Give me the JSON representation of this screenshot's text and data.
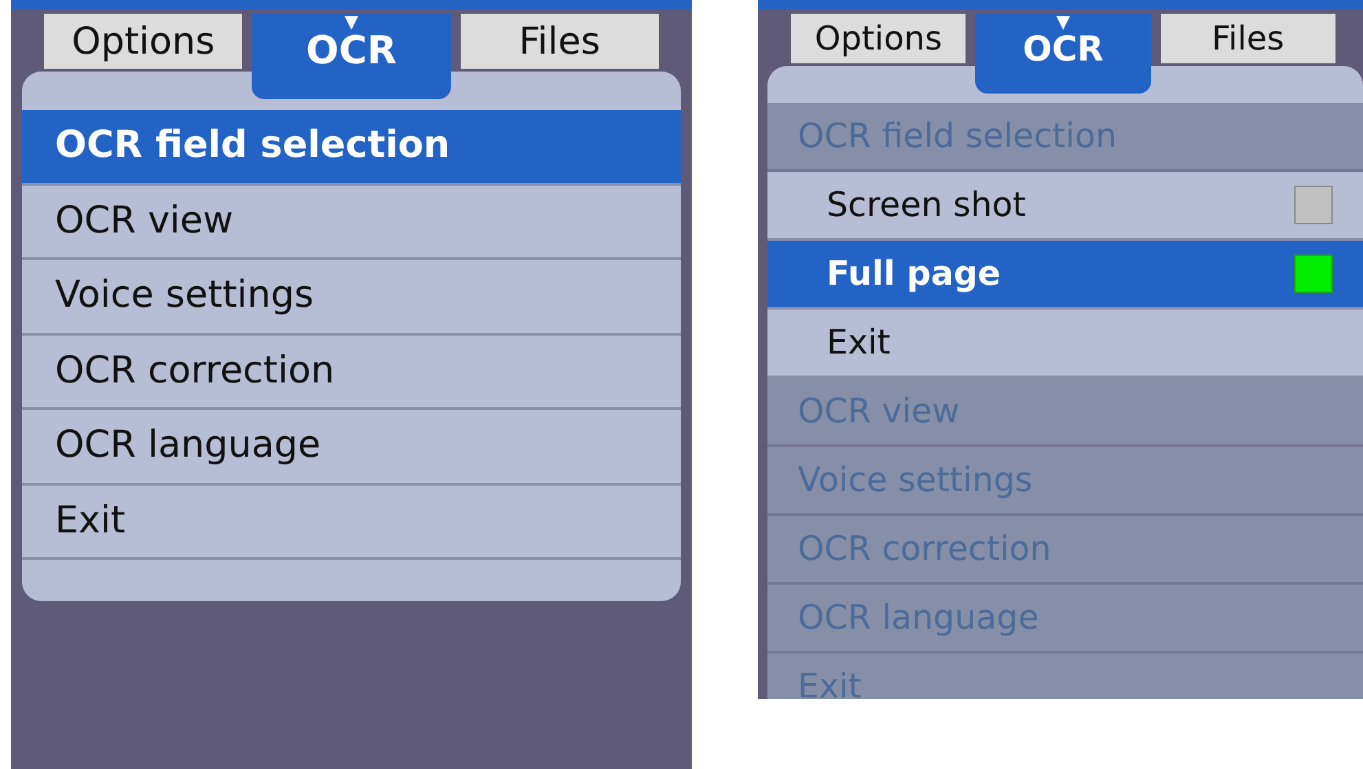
{
  "screens": [
    {
      "tabs": [
        {
          "label": "Options",
          "selected": false
        },
        {
          "label": "OCR",
          "selected": true,
          "indicator": "▼"
        },
        {
          "label": "Files",
          "selected": false
        }
      ],
      "menu": [
        {
          "label": "OCR field selection",
          "selected": true,
          "disabled": false
        },
        {
          "label": "OCR view",
          "selected": false,
          "disabled": false
        },
        {
          "label": "Voice settings",
          "selected": false,
          "disabled": false
        },
        {
          "label": "OCR correction",
          "selected": false,
          "disabled": false
        },
        {
          "label": "OCR language",
          "selected": false,
          "disabled": false
        },
        {
          "label": "Exit",
          "selected": false,
          "disabled": false
        }
      ]
    },
    {
      "tabs": [
        {
          "label": "Options",
          "selected": false
        },
        {
          "label": "OCR",
          "selected": true,
          "indicator": "▼"
        },
        {
          "label": "Files",
          "selected": false
        }
      ],
      "menu": [
        {
          "label": "OCR field selection",
          "selected": false,
          "disabled": true,
          "children": [
            {
              "kind": "option",
              "label": "Screen shot",
              "selected": false,
              "checked": false
            },
            {
              "kind": "option",
              "label": "Full page",
              "selected": true,
              "checked": true
            },
            {
              "kind": "action",
              "label": "Exit",
              "selected": false
            }
          ]
        },
        {
          "label": "OCR view",
          "selected": false,
          "disabled": true
        },
        {
          "label": "Voice settings",
          "selected": false,
          "disabled": true
        },
        {
          "label": "OCR correction",
          "selected": false,
          "disabled": true
        },
        {
          "label": "OCR language",
          "selected": false,
          "disabled": true
        },
        {
          "label": "Exit",
          "selected": false,
          "disabled": true
        }
      ]
    }
  ]
}
